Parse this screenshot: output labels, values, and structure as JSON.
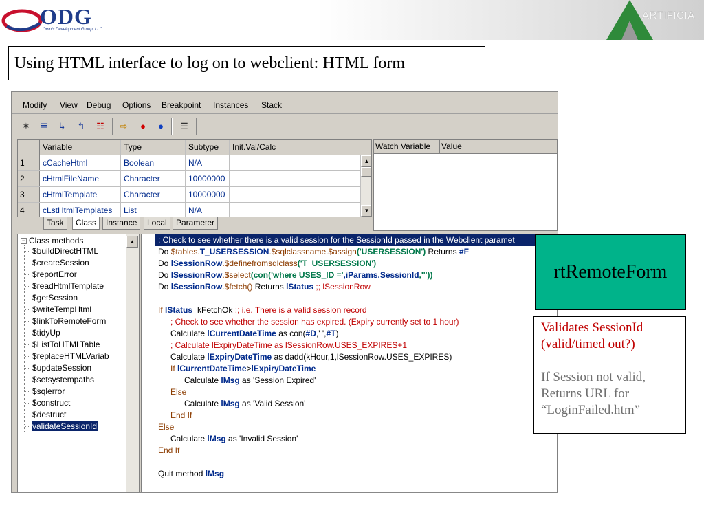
{
  "header": {
    "odg_logo_text": "ODG",
    "odg_tagline": "Omnis Development Group, LLC",
    "artificia_logo_text": "ARTIFICIA"
  },
  "title": "Using HTML interface to log on to webclient: HTML form",
  "menu": [
    {
      "label": "Modify",
      "key": "M"
    },
    {
      "label": "View",
      "key": "V"
    },
    {
      "label": "Debug",
      "key": "g"
    },
    {
      "label": "Options",
      "key": "O"
    },
    {
      "label": "Breakpoint",
      "key": "B"
    },
    {
      "label": "Instances",
      "key": "I"
    },
    {
      "label": "Stack",
      "key": "S"
    }
  ],
  "toolbar": {
    "icons": [
      "step-icon",
      "step-over-icon",
      "step-in-icon",
      "step-out-icon",
      "trace-icon",
      "go-point-icon",
      "breakpoint-red-icon",
      "breakpoint-blue-icon",
      "field-icon"
    ]
  },
  "variables": {
    "headers": [
      "Variable",
      "Type",
      "Subtype",
      "Init.Val/Calc"
    ],
    "rows": [
      {
        "num": "1",
        "variable": "cCacheHtml",
        "type": "Boolean",
        "subtype": "N/A",
        "init": ""
      },
      {
        "num": "2",
        "variable": "cHtmlFileName",
        "type": "Character",
        "subtype": "10000000",
        "init": ""
      },
      {
        "num": "3",
        "variable": "cHtmlTemplate",
        "type": "Character",
        "subtype": "10000000",
        "init": ""
      },
      {
        "num": "4",
        "variable": "cLstHtmlTemplates",
        "type": "List",
        "subtype": "N/A",
        "init": ""
      }
    ]
  },
  "tabs": [
    "Task",
    "Class",
    "Instance",
    "Local",
    "Parameter"
  ],
  "watch": {
    "headers": [
      "Watch Variable",
      "Value"
    ]
  },
  "tree": {
    "root": "Class methods",
    "items": [
      "$buildDirectHTML",
      "$createSession",
      "$reportError",
      "$readHtmlTemplate",
      "$getSession",
      "$writeTempHtml",
      "$linkToRemoteForm",
      "$tidyUp",
      "$ListToHTMLTable",
      "$replaceHTMLVariab",
      "$updateSession",
      "$setsystempaths",
      "$sqlerror",
      "$construct",
      "$destruct",
      "validateSessionId"
    ],
    "selected": "validateSessionId"
  },
  "code": {
    "l1": "; Check to see whether there is a valid session for the SessionId passed in the Webclient paramet",
    "l2a": "Do ",
    "l2b": "$tables.",
    "l2c": "T_USERSESSION",
    "l2d": ".$sqlclassname.$assign",
    "l2e": "('USERSESSION')",
    "l2f": " Returns ",
    "l2g": "#F",
    "l3a": "Do ",
    "l3b": "lSessionRow",
    "l3c": ".$definefromsqlclass",
    "l3d": "('T_USERSESSION')",
    "l4a": "Do ",
    "l4b": "lSessionRow",
    "l4c": ".$select",
    "l4d": "(con(",
    "l4e": "'where USES_ID ='",
    "l4f": ",iParams.SessionId",
    "l4g": ",'''))",
    "l5a": "Do ",
    "l5b": "lSessionRow",
    "l5c": ".$fetch()",
    "l5d": " Returns ",
    "l5e": "lStatus",
    "l5f": "     ;; lSessionRow",
    "l6a": "If ",
    "l6b": "lStatus",
    "l6c": "=kFetchOk",
    "l6d": "     ;; i.e. There is a valid session record",
    "l7": "; Check to see whether the session has expired. (Expiry currently set to 1 hour)",
    "l8a": "Calculate ",
    "l8b": "lCurrentDateTime",
    "l8c": " as con(",
    "l8d": "#D",
    "l8e": ",' ',",
    "l8f": "#T",
    "l8g": ")",
    "l9": "; Calculate lExpiryDateTime as lSessionRow.USES_EXPIRES+1",
    "l10a": "Calculate ",
    "l10b": "lExpiryDateTime",
    "l10c": " as dadd(kHour,1,lSessionRow.USES_EXPIRES)",
    "l11a": "If ",
    "l11b": "lCurrentDateTime",
    "l11c": ">",
    "l11d": "lExpiryDateTime",
    "l12a": "Calculate ",
    "l12b": "lMsg",
    "l12c": " as 'Session Expired'",
    "l13": "Else",
    "l14a": "Calculate ",
    "l14b": "lMsg",
    "l14c": " as 'Valid Session'",
    "l15": "End If",
    "l16": "Else",
    "l17a": "Calculate ",
    "l17b": "lMsg",
    "l17c": " as 'Invalid Session'",
    "l18": "End If",
    "l19a": "Quit method ",
    "l19b": "lMsg"
  },
  "green_label": "rtRemoteForm",
  "note": {
    "line1": "Validates SessionId",
    "line2": "(valid/timed out?)",
    "line3": "If Session not valid,",
    "line4": "Returns URL for",
    "line5": "“LoginFailed.htm”"
  },
  "colors": {
    "accent_green": "#00b38a",
    "comment_red": "#c00000",
    "selection_navy": "#0a246a"
  }
}
